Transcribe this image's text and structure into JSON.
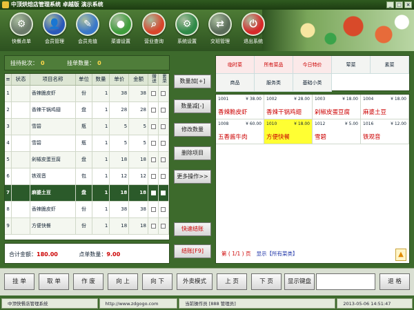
{
  "window": {
    "title": "中顶烘焙店管理系统  卓越版  演示系统",
    "controls": [
      "_",
      "□",
      "×"
    ]
  },
  "toolbar": [
    {
      "label": "快餐点单",
      "icon": "order-icon",
      "color": "#6b7a6a",
      "glyph": "⚙"
    },
    {
      "label": "会员管理",
      "icon": "member-icon",
      "color": "#2b59b9",
      "glyph": "👤"
    },
    {
      "label": "会员充值",
      "icon": "recharge-icon",
      "color": "#3a78c9",
      "glyph": "✎"
    },
    {
      "label": "菜谱设置",
      "icon": "menu-setting-icon",
      "color": "#3f9d3c",
      "glyph": "●"
    },
    {
      "label": "营业查询",
      "icon": "search-icon",
      "color": "#d8462c",
      "glyph": "⌕"
    },
    {
      "label": "系统设置",
      "icon": "gear-icon",
      "color": "#2f8a48",
      "glyph": "⚙"
    },
    {
      "label": "交班管理",
      "icon": "shift-icon",
      "color": "#5b6c5a",
      "glyph": "⇄"
    },
    {
      "label": "退出系统",
      "icon": "power-icon",
      "color": "#d72a2a",
      "glyph": "⏻"
    }
  ],
  "summary": {
    "batch_label": "挂待批次：",
    "batch_value": "0",
    "order_label": "挂单数量：",
    "order_value": "0"
  },
  "order_table": {
    "headers": [
      "状态",
      "项目名称",
      "单位",
      "数量",
      "单价",
      "金额",
      "赠送",
      "套菜"
    ],
    "rows": [
      {
        "no": "1",
        "name": "香辣脆皮虾",
        "unit": "份",
        "qty": "1",
        "price": "38",
        "amount": "38"
      },
      {
        "no": "2",
        "name": "香辣干锅鸡翅",
        "unit": "盘",
        "qty": "1",
        "price": "28",
        "amount": "28"
      },
      {
        "no": "3",
        "name": "雪碧",
        "unit": "瓶",
        "qty": "1",
        "price": "5",
        "amount": "5"
      },
      {
        "no": "4",
        "name": "雪碧",
        "unit": "瓶",
        "qty": "1",
        "price": "5",
        "amount": "5"
      },
      {
        "no": "5",
        "name": "剁椒皮蛋豆腐",
        "unit": "盘",
        "qty": "1",
        "price": "18",
        "amount": "18"
      },
      {
        "no": "6",
        "name": "铁观音",
        "unit": "包",
        "qty": "1",
        "price": "12",
        "amount": "12"
      },
      {
        "no": "7",
        "name": "麻婆土豆",
        "unit": "盘",
        "qty": "1",
        "price": "18",
        "amount": "18",
        "selected": true
      },
      {
        "no": "8",
        "name": "香辣脆皮虾",
        "unit": "份",
        "qty": "1",
        "price": "38",
        "amount": "38"
      },
      {
        "no": "9",
        "name": "方便快餐",
        "unit": "份",
        "qty": "1",
        "price": "18",
        "amount": "18"
      }
    ]
  },
  "totals": {
    "amount_label": "合计金额：",
    "amount_value": "180.00",
    "count_label": "点单数量：",
    "count_value": "9.00"
  },
  "middle_buttons": [
    "数量加[+]",
    "数量减[-]",
    "修改数量",
    "删除项目",
    "更多操作>>"
  ],
  "middle_red_buttons": [
    "快速结账",
    "结账[F9]"
  ],
  "categories_row1": [
    "临时菜",
    "所有菜品",
    "今日特价",
    "荤菜",
    "素菜"
  ],
  "categories_row2": [
    "商品",
    "服务类",
    "基础小类"
  ],
  "dishes": [
    {
      "code": "1001",
      "price": "¥ 38.00",
      "name": "香辣脆皮虾"
    },
    {
      "code": "1002",
      "price": "¥ 28.00",
      "name": "香辣干锅鸡翅"
    },
    {
      "code": "1003",
      "price": "¥ 18.00",
      "name": "剁椒皮蛋豆腐"
    },
    {
      "code": "1004",
      "price": "¥ 18.00",
      "name": "麻婆土豆"
    },
    {
      "code": "1008",
      "price": "¥ 60.00",
      "name": "五香酱牛肉"
    },
    {
      "code": "1010",
      "price": "¥ 18.00",
      "name": "方便快餐",
      "highlight": true
    },
    {
      "code": "1012",
      "price": "¥ 5.00",
      "name": "雪碧"
    },
    {
      "code": "1016",
      "price": "¥ 12.00",
      "name": "铁观音"
    }
  ],
  "pager": {
    "text": "第  ( 1/1 )  页",
    "display": "显示【所有菜类】"
  },
  "bottom_buttons": [
    "挂 单",
    "取 单",
    "作 废",
    "向 上",
    "向 下",
    "外卖模式",
    "上 页",
    "下 页",
    "显示键盘"
  ],
  "exit_button": "退 格",
  "status": {
    "company": "中顶快餐店管理系统",
    "url": "http://www.zdgogo.com",
    "operator": "当前操作员 [888 管理员]",
    "datetime": "2013-05-06 14:51:47"
  }
}
